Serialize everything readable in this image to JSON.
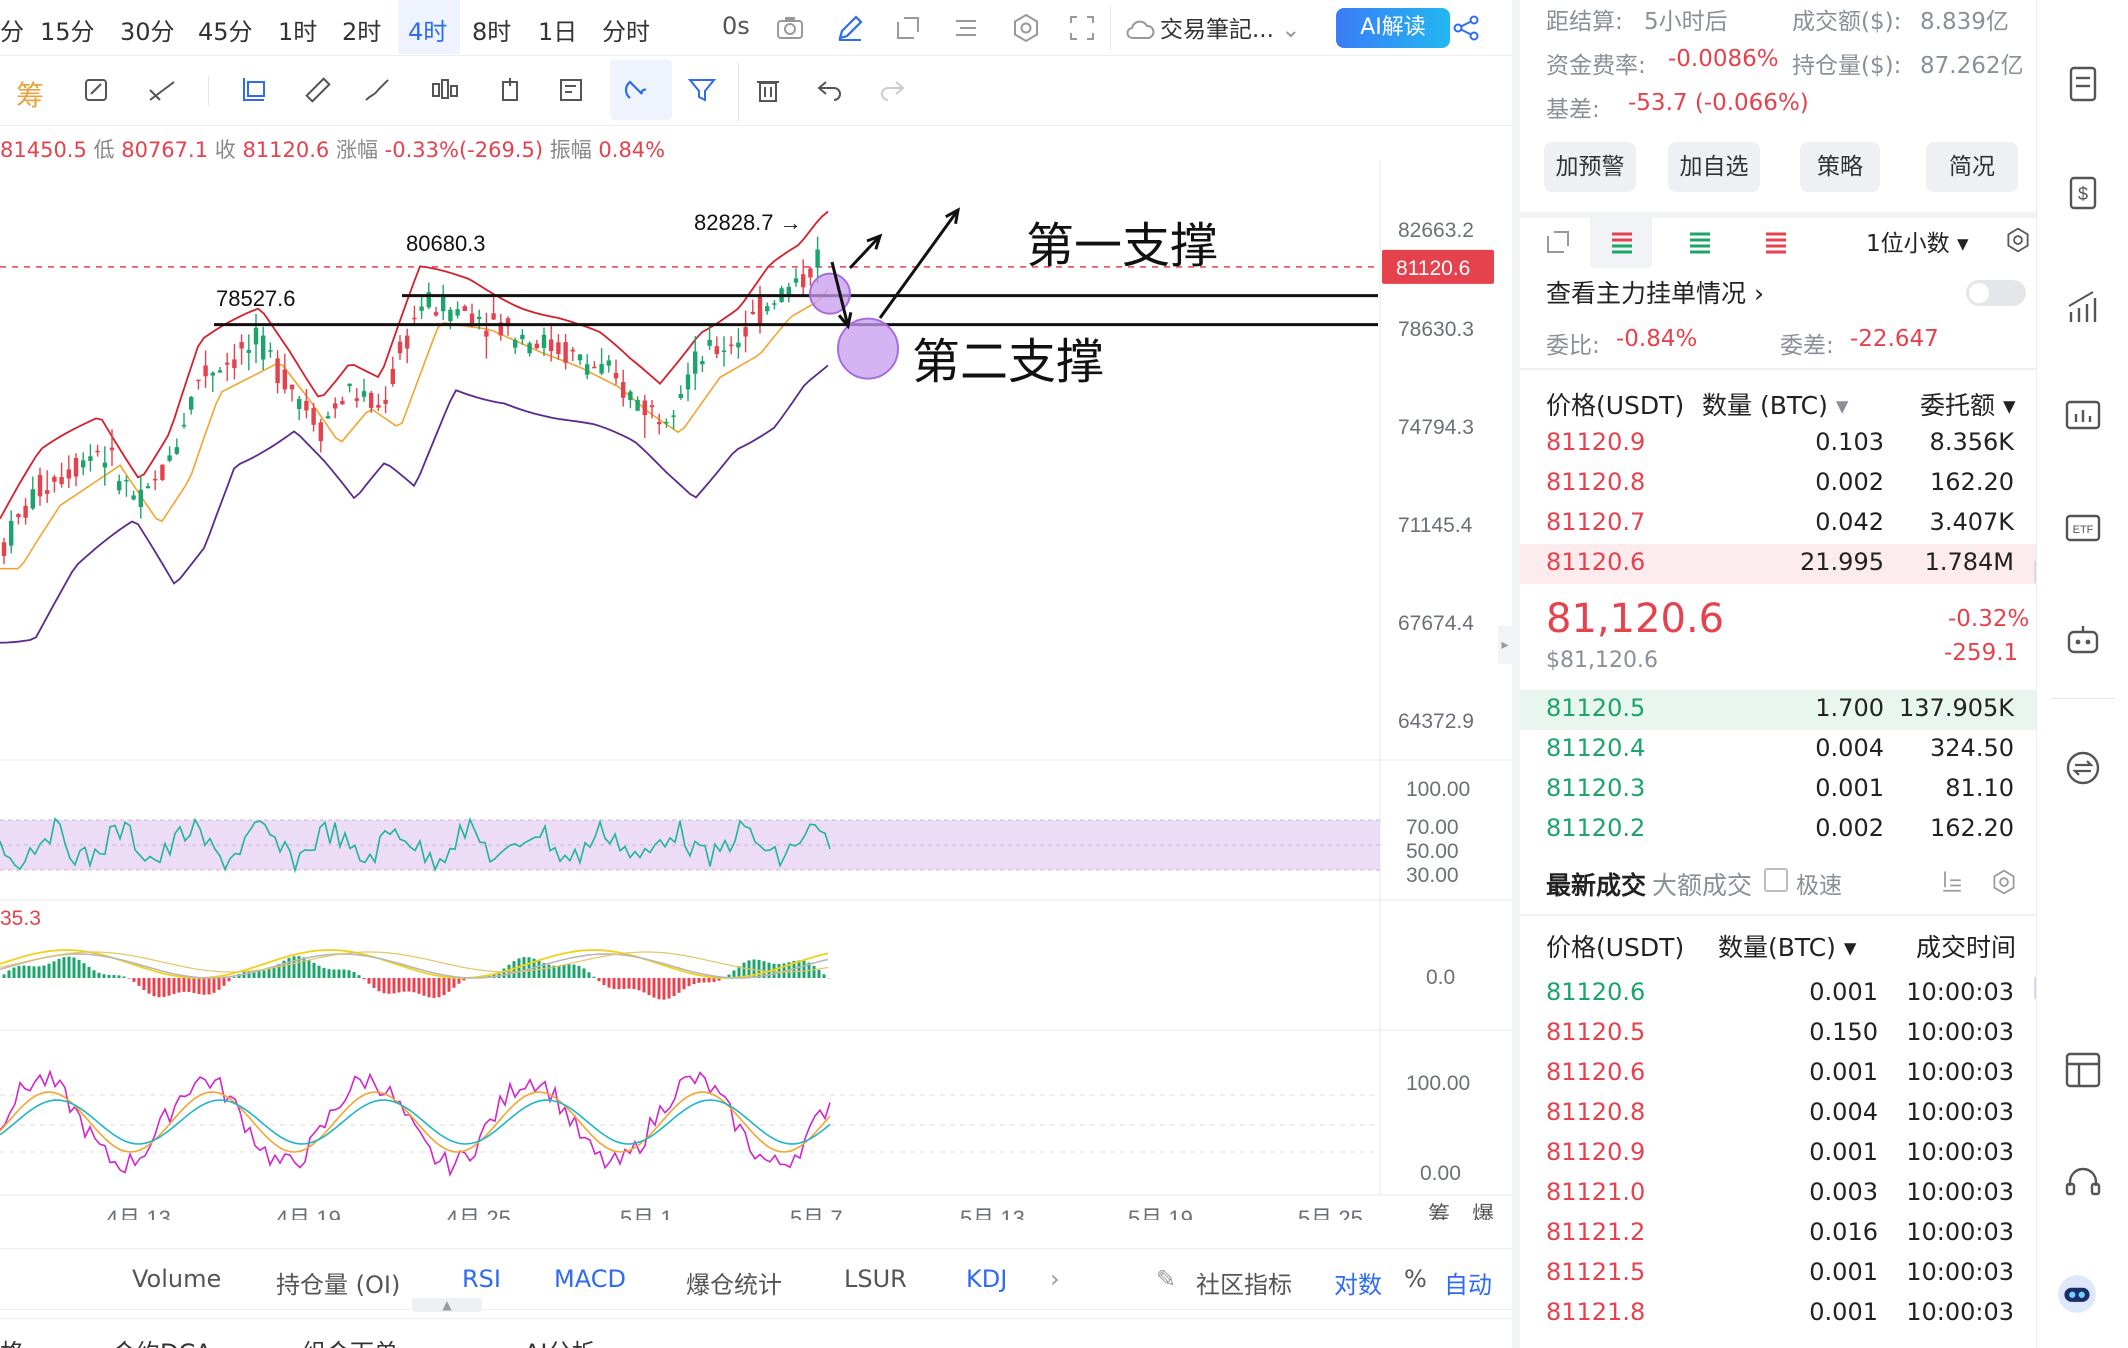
{
  "toolbar": {
    "timeframes": [
      "分",
      "15分",
      "30分",
      "45分",
      "1时",
      "2时",
      "4时",
      "8时",
      "1日",
      "分时"
    ],
    "active_timeframe": "4时",
    "countdown": "0s",
    "note_label": "交易筆記...",
    "ai_label": "AI解读"
  },
  "ohlc": {
    "high_value": "81450.5",
    "low_label": "低",
    "low_value": "80767.1",
    "close_label": "收",
    "close_value": "81120.6",
    "change_label": "涨幅",
    "change_value": "-0.33%(-269.5)",
    "amp_label": "振幅",
    "amp_value": "0.84%"
  },
  "chart_data": {
    "type": "candlestick",
    "price_axis": [
      "82663.2",
      "78630.3",
      "74794.3",
      "71145.4",
      "67674.4",
      "64372.9"
    ],
    "current_price_tag": "81120.6",
    "date_axis": [
      "4月 13",
      "4月 19",
      "4月 25",
      "5月 1",
      "5月 7",
      "5月 13",
      "5月 19",
      "5月 25"
    ],
    "level_labels": [
      "80680.3",
      "78527.6",
      "82828.7 →"
    ],
    "annotations": [
      "第一支撑",
      "第二支撑"
    ],
    "rsi_axis": [
      "100.00",
      "70.00",
      "50.00",
      "30.00"
    ],
    "macd_label": "35.3",
    "macd_axis": [
      "0.0"
    ],
    "kdj_axis": [
      "100.00",
      "0.00"
    ],
    "corner_labels": [
      "筹",
      "爆"
    ]
  },
  "indicators": {
    "items": [
      "Volume",
      "持仓量 (OI)",
      "RSI",
      "MACD",
      "爆仓统计",
      "LSUR",
      "KDJ"
    ],
    "active": [
      "RSI",
      "MACD",
      "KDJ"
    ],
    "community": "社区指标",
    "log_label": "对数",
    "pct_label": "%",
    "auto_label": "自动"
  },
  "bottom_tabs": [
    "格",
    "合约DCA",
    "组合下单",
    "AI分析"
  ],
  "stats": {
    "settle_label": "距结算:",
    "settle_value": "5小时后",
    "vol_label": "成交额($):",
    "vol_value": "8.839亿",
    "funding_label": "资金费率:",
    "funding_value": "-0.0086%",
    "oi_label": "持仓量($):",
    "oi_value": "87.262亿",
    "basis_label": "基差:",
    "basis_value": "-53.7 (-0.066%)"
  },
  "actions": [
    "加预警",
    "加自选",
    "策略",
    "简况"
  ],
  "orderbook": {
    "precision": "1位小数",
    "main_orders": "查看主力挂单情况",
    "ratio_label": "委比:",
    "ratio_value": "-0.84%",
    "diff_label": "委差:",
    "diff_value": "-22.647",
    "headers": [
      "价格(USDT)",
      "数量 (BTC)",
      "委托额"
    ],
    "asks": [
      {
        "price": "81120.9",
        "qty": "0.103",
        "amount": "8.356K"
      },
      {
        "price": "81120.8",
        "qty": "0.002",
        "amount": "162.20"
      },
      {
        "price": "81120.7",
        "qty": "0.042",
        "amount": "3.407K"
      },
      {
        "price": "81120.6",
        "qty": "21.995",
        "amount": "1.784M"
      }
    ],
    "last_price": "81,120.6",
    "last_usd": "$81,120.6",
    "change_pct": "-0.32%",
    "change_abs": "-259.1",
    "bids": [
      {
        "price": "81120.5",
        "qty": "1.700",
        "amount": "137.905K"
      },
      {
        "price": "81120.4",
        "qty": "0.004",
        "amount": "324.50"
      },
      {
        "price": "81120.3",
        "qty": "0.001",
        "amount": "81.10"
      },
      {
        "price": "81120.2",
        "qty": "0.002",
        "amount": "162.20"
      }
    ]
  },
  "trades": {
    "tab_latest": "最新成交",
    "tab_large": "大额成交",
    "fast_label": "极速",
    "headers": [
      "价格(USDT)",
      "数量(BTC)",
      "成交时间"
    ],
    "rows": [
      {
        "price": "81120.6",
        "qty": "0.001",
        "time": "10:00:03",
        "side": "buy"
      },
      {
        "price": "81120.5",
        "qty": "0.150",
        "time": "10:00:03",
        "side": "sell"
      },
      {
        "price": "81120.6",
        "qty": "0.001",
        "time": "10:00:03",
        "side": "sell"
      },
      {
        "price": "81120.8",
        "qty": "0.004",
        "time": "10:00:03",
        "side": "sell"
      },
      {
        "price": "81120.9",
        "qty": "0.001",
        "time": "10:00:03",
        "side": "sell"
      },
      {
        "price": "81121.0",
        "qty": "0.003",
        "time": "10:00:03",
        "side": "sell"
      },
      {
        "price": "81121.2",
        "qty": "0.016",
        "time": "10:00:03",
        "side": "sell"
      },
      {
        "price": "81121.5",
        "qty": "0.001",
        "time": "10:00:03",
        "side": "sell"
      },
      {
        "price": "81121.8",
        "qty": "0.001",
        "time": "10:00:03",
        "side": "sell"
      }
    ]
  },
  "colors": {
    "up": "#1ba56a",
    "down": "#e5424d",
    "accent": "#2f6bf0",
    "boll_upper": "#d61f2c",
    "boll_mid": "#f2a531",
    "boll_lower": "#5b2a8c",
    "highlight_circle": "#c89bf0"
  }
}
